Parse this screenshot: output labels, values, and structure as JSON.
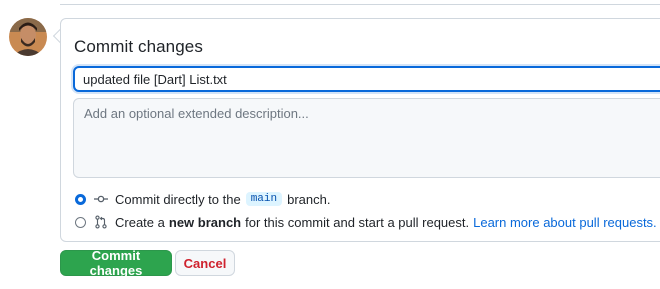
{
  "avatar": {
    "icon": "user-avatar"
  },
  "panel": {
    "title": "Commit changes",
    "summary_value": "updated file [Dart] List.txt",
    "description_placeholder": "Add an optional extended description..."
  },
  "options": {
    "direct": {
      "selected": true,
      "icon": "git-commit-icon",
      "text_before": "Commit directly to the",
      "branch": "main",
      "text_after": "branch."
    },
    "new_branch": {
      "selected": false,
      "icon": "git-pull-request-icon",
      "text_before": "Create a",
      "strong": "new branch",
      "text_after": "for this commit and start a pull request.",
      "link": "Learn more about pull requests."
    }
  },
  "buttons": {
    "commit_label": "Commit changes",
    "cancel_label": "Cancel"
  },
  "colors": {
    "primary_green": "#2da44e",
    "accent_blue": "#0969da",
    "danger_red": "#cf222e"
  }
}
